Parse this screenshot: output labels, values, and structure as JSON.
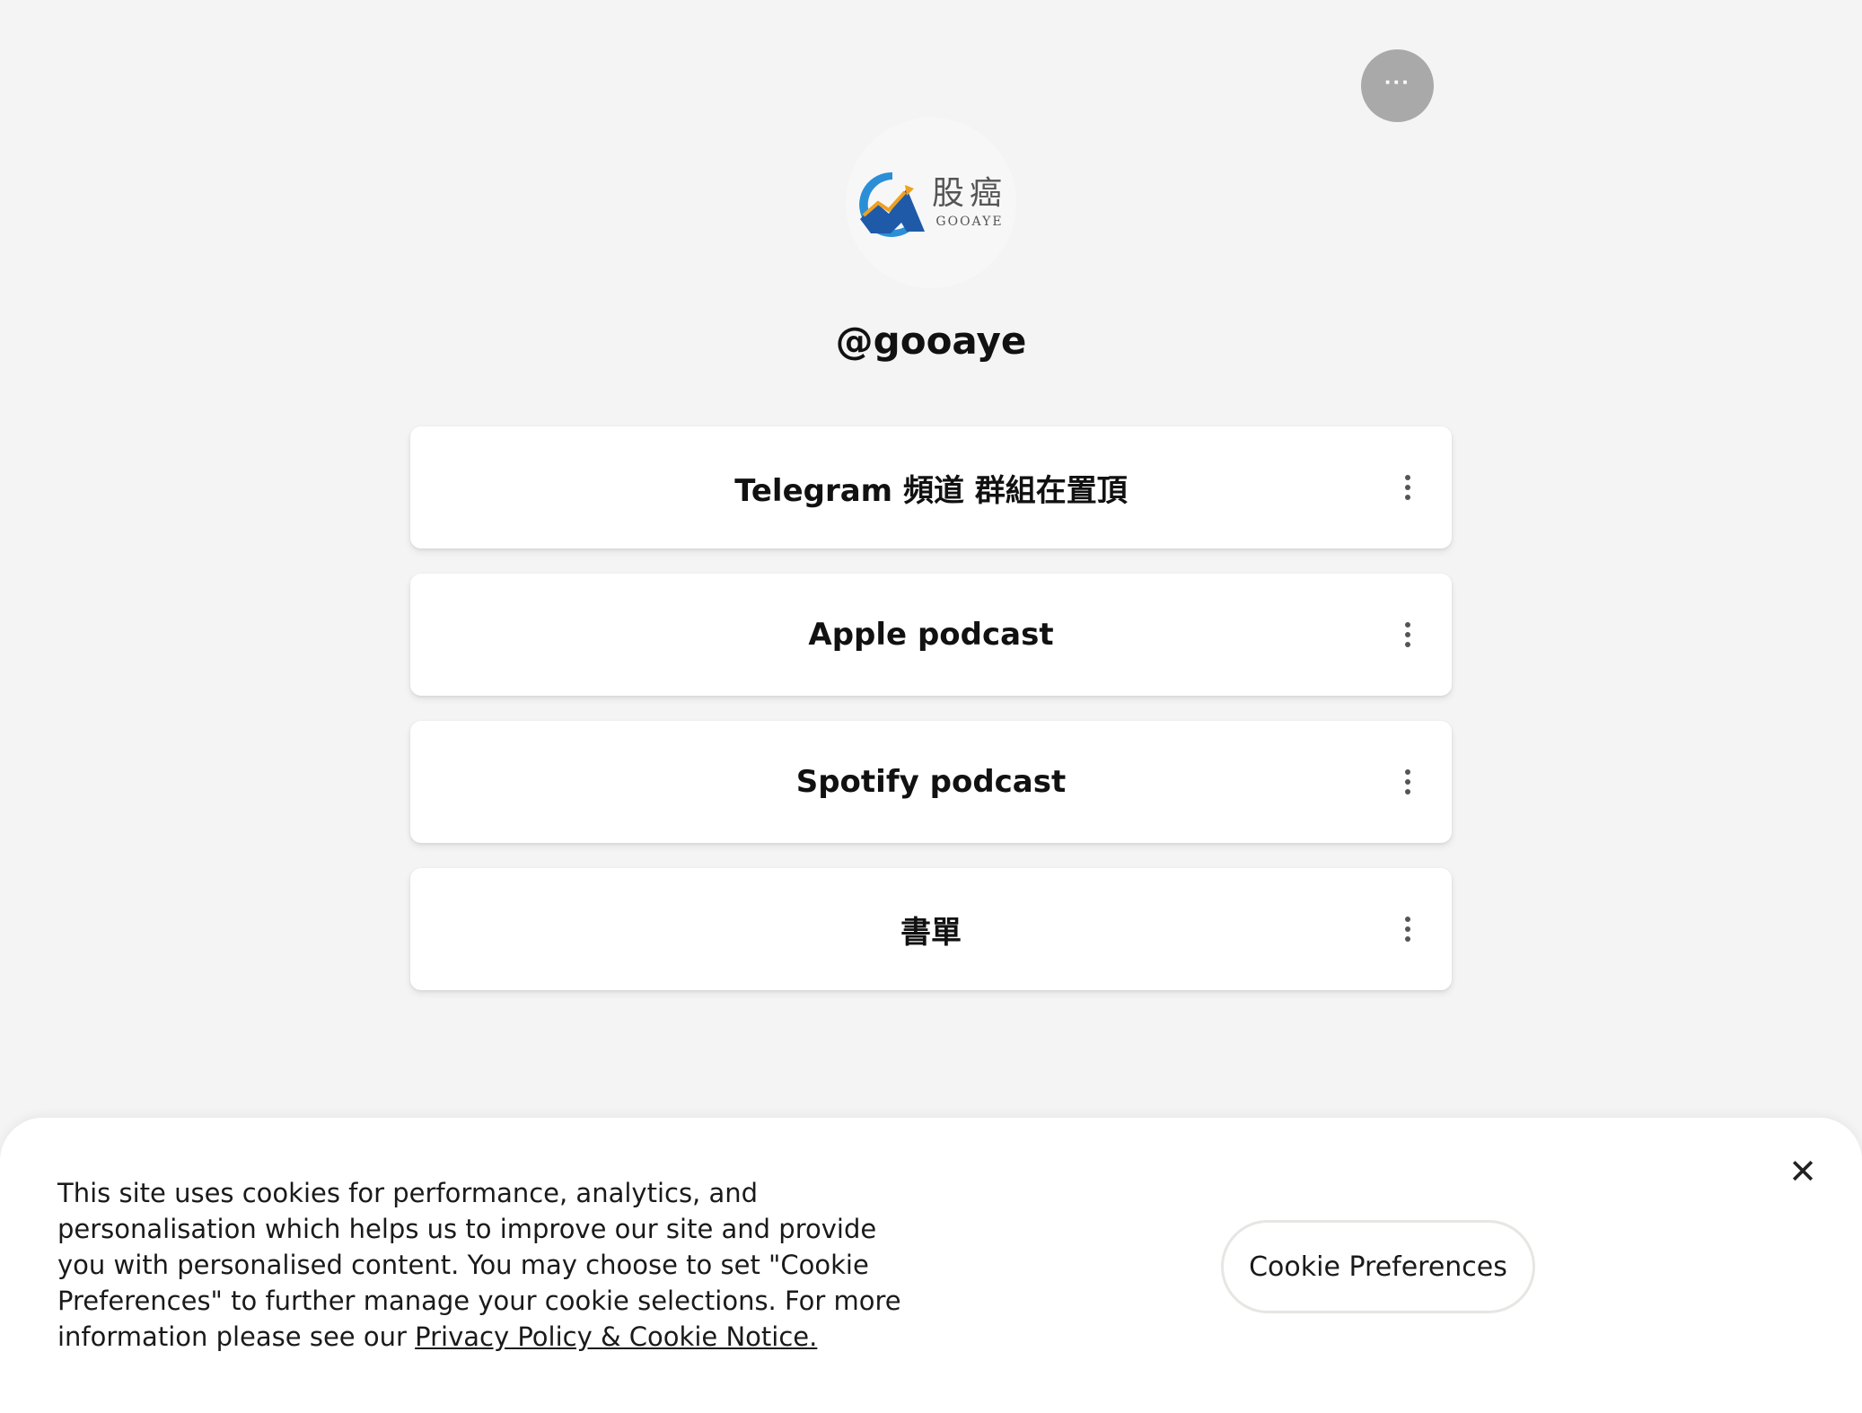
{
  "header": {
    "more_button_label": "···"
  },
  "profile": {
    "logo_text_cn": "股癌",
    "logo_text_en": "GOOAYE",
    "handle": "@gooaye"
  },
  "links": [
    {
      "label": "Telegram 頻道 群組在置頂"
    },
    {
      "label": "Apple podcast"
    },
    {
      "label": "Spotify podcast"
    },
    {
      "label": "書單"
    }
  ],
  "cookie_banner": {
    "text": "This site uses cookies for performance, analytics, and personalisation which helps us to improve our site and provide you with personalised content. You may choose to set \"Cookie Preferences\" to further manage your cookie selections. For more information please see our ",
    "link_label": "Privacy Policy & Cookie Notice.",
    "preferences_button": "Cookie Preferences",
    "close_label": "✕"
  },
  "colors": {
    "background": "#f4f4f4",
    "card": "#ffffff",
    "logo_blue": "#2a8fd6",
    "logo_navy": "#1f5aa8",
    "logo_orange": "#f0a020"
  }
}
